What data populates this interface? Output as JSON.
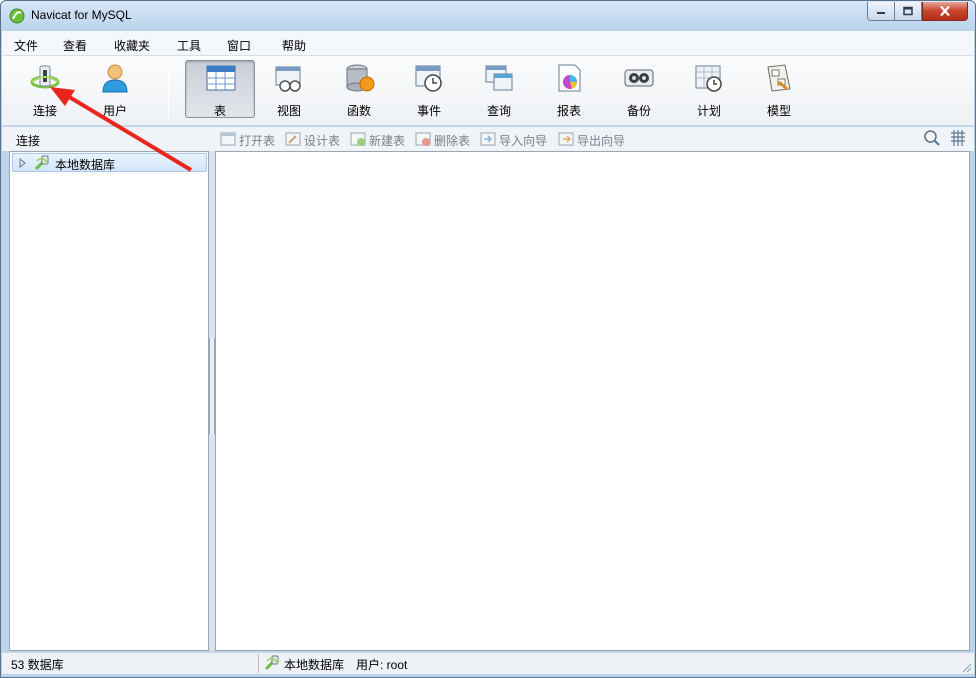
{
  "window": {
    "title": "Navicat for MySQL"
  },
  "menu": [
    "文件",
    "查看",
    "收藏夹",
    "工具",
    "窗口",
    "帮助"
  ],
  "toolbar": {
    "connection": "连接",
    "user": "用户",
    "table": "表",
    "view": "视图",
    "function": "函数",
    "event": "事件",
    "query": "查询",
    "report": "报表",
    "backup": "备份",
    "schedule": "计划",
    "model": "模型",
    "selected": "表"
  },
  "subbar": {
    "connection_label": "连接",
    "open_table": "打开表",
    "design_table": "设计表",
    "new_table": "新建表",
    "delete_table": "删除表",
    "import_wizard": "导入向导",
    "export_wizard": "导出向导"
  },
  "tree": {
    "items": [
      {
        "label": "本地数据库"
      }
    ]
  },
  "status": {
    "db_count": "53 数据库",
    "connection": "本地数据库",
    "user": "用户: root"
  },
  "colors": {
    "accent": "#bcd3ec",
    "selection": "#d3e6fb",
    "annotation_arrow": "#e8261c"
  }
}
